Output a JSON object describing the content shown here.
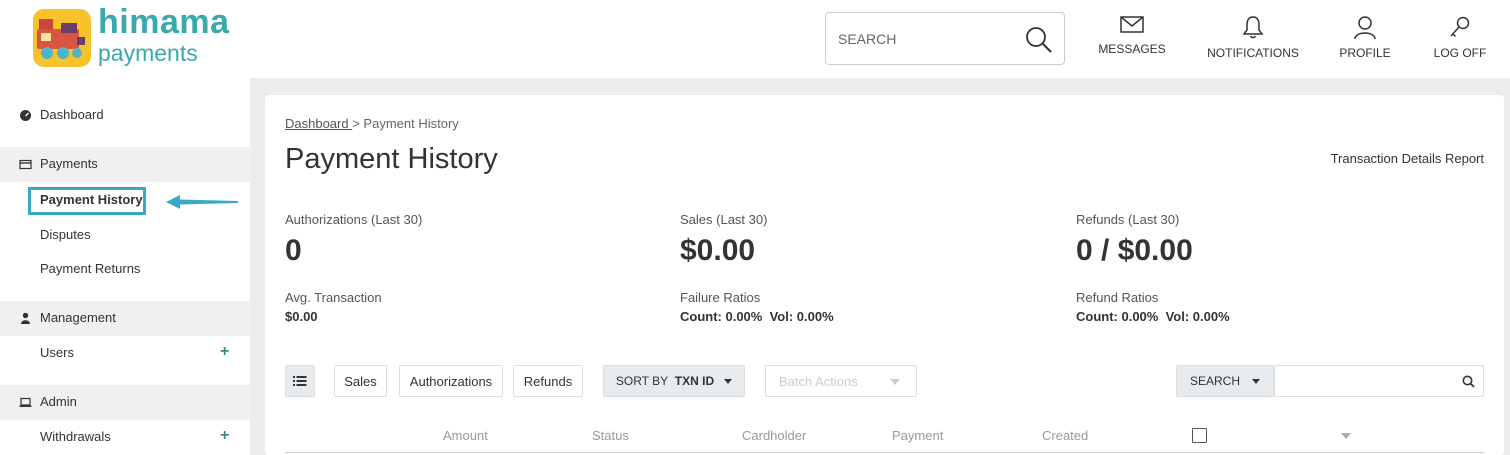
{
  "app": {
    "logo_line1": "himama",
    "logo_line2": "payments"
  },
  "header": {
    "search_placeholder": "SEARCH",
    "nav": [
      {
        "label": "MESSAGES",
        "icon": "envelope-icon"
      },
      {
        "label": "NOTIFICATIONS",
        "icon": "bell-icon"
      },
      {
        "label": "PROFILE",
        "icon": "user-icon"
      },
      {
        "label": "LOG OFF",
        "icon": "key-icon"
      }
    ]
  },
  "sidebar": {
    "dashboard": "Dashboard",
    "payments": "Payments",
    "payment_history": "Payment History",
    "disputes": "Disputes",
    "payment_returns": "Payment Returns",
    "management": "Management",
    "users": "Users",
    "admin": "Admin",
    "withdrawals": "Withdrawals",
    "plus": "+"
  },
  "main": {
    "breadcrumb_link": "Dashboard ",
    "breadcrumb_sep": "> Payment History",
    "title": "Payment History",
    "report_link": "Transaction Details Report",
    "stats": {
      "auth_label": "Authorizations (Last 30)",
      "auth_value": "0",
      "sales_label": "Sales (Last 30)",
      "sales_value": "$0.00",
      "refunds_label": "Refunds (Last 30)",
      "refunds_value": "0 / $0.00",
      "avg_label": "Avg. Transaction",
      "avg_value": "$0.00",
      "failure_label": "Failure Ratios",
      "failure_value": "Count: 0.00%  Vol: 0.00%",
      "refund_ratio_label": "Refund Ratios",
      "refund_ratio_value": "Count: 0.00%  Vol: 0.00%"
    },
    "toolbar": {
      "sales": "Sales",
      "authorizations": "Authorizations",
      "refunds": "Refunds",
      "sort_prefix": "SORT BY",
      "sort_value": "TXN ID",
      "batch_actions": "Batch Actions",
      "search_label": "SEARCH"
    },
    "columns": [
      "Amount",
      "Status",
      "Cardholder",
      "Payment",
      "Created"
    ]
  },
  "colors": {
    "accent": "#3aa9ac",
    "highlight": "#3aa9c4"
  }
}
